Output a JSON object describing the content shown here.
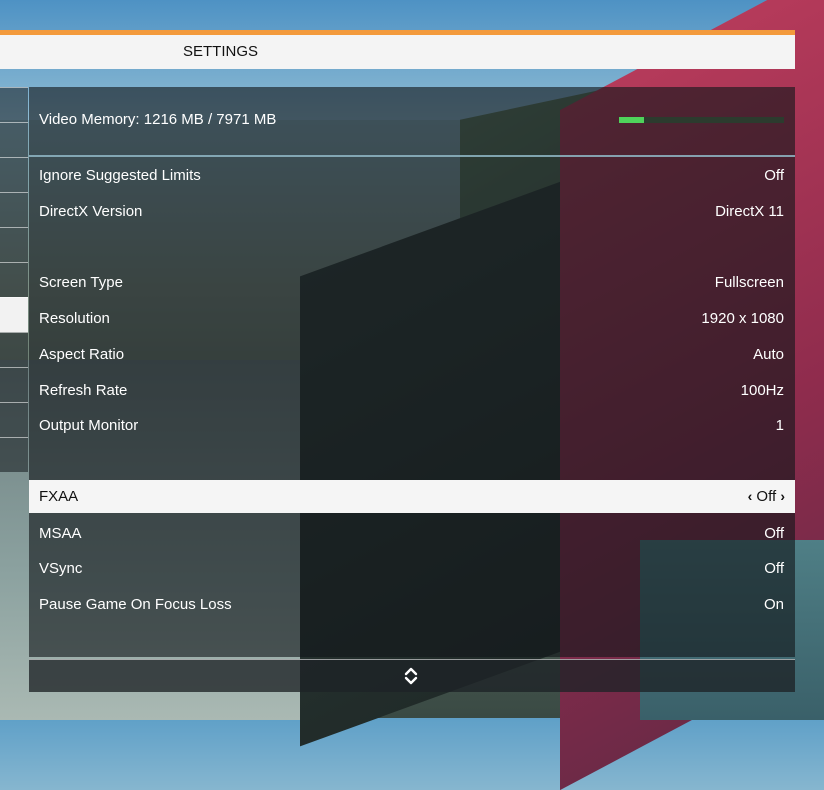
{
  "header": {
    "title": "SETTINGS"
  },
  "video_memory": {
    "label": "Video Memory: 1216 MB / 7971 MB",
    "usage_fraction": 0.153
  },
  "settings": [
    {
      "label": "Ignore Suggested Limits",
      "value": "Off"
    },
    {
      "label": "DirectX Version",
      "value": "DirectX 11"
    },
    {
      "label": "Screen Type",
      "value": "Fullscreen"
    },
    {
      "label": "Resolution",
      "value": "1920 x 1080"
    },
    {
      "label": "Aspect Ratio",
      "value": "Auto"
    },
    {
      "label": "Refresh Rate",
      "value": "100Hz"
    },
    {
      "label": "Output Monitor",
      "value": "1"
    },
    {
      "label": "FXAA",
      "value": "Off"
    },
    {
      "label": "MSAA",
      "value": "Off"
    },
    {
      "label": "VSync",
      "value": "Off"
    },
    {
      "label": "Pause Game On Focus Loss",
      "value": "On"
    }
  ],
  "colors": {
    "accent": "#f39a3c",
    "memory_bar": "#4fd35b",
    "selected_row": "#f5f5f5"
  },
  "icons": {
    "footer": "scroll-up-down-icon",
    "left": "chevron-left-icon",
    "right": "chevron-right-icon"
  }
}
